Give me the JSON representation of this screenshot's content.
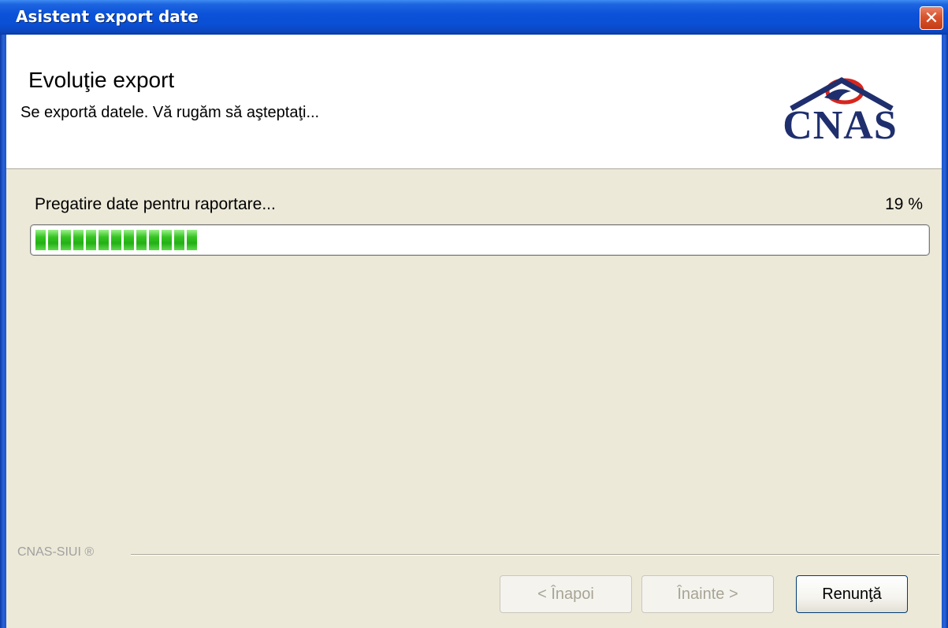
{
  "window": {
    "title": "Asistent export date",
    "close_glyph": "✕"
  },
  "header": {
    "title": "Evoluţie export",
    "subtitle": "Se exportă datele. Vă rugăm să aşteptaţi...",
    "logo_text": "CNAS",
    "logo_color": "#1F2F6E",
    "logo_accent": "#D7261E"
  },
  "progress": {
    "status": "Pregatire date pentru raportare...",
    "percent_label": "19 %",
    "value": 0.19,
    "fill_color": "#2BB81A"
  },
  "footer": {
    "brand": "CNAS-SIUI ®",
    "back_label": "< Înapoi",
    "next_label": "Înainte >",
    "cancel_label": "Renunţă"
  }
}
